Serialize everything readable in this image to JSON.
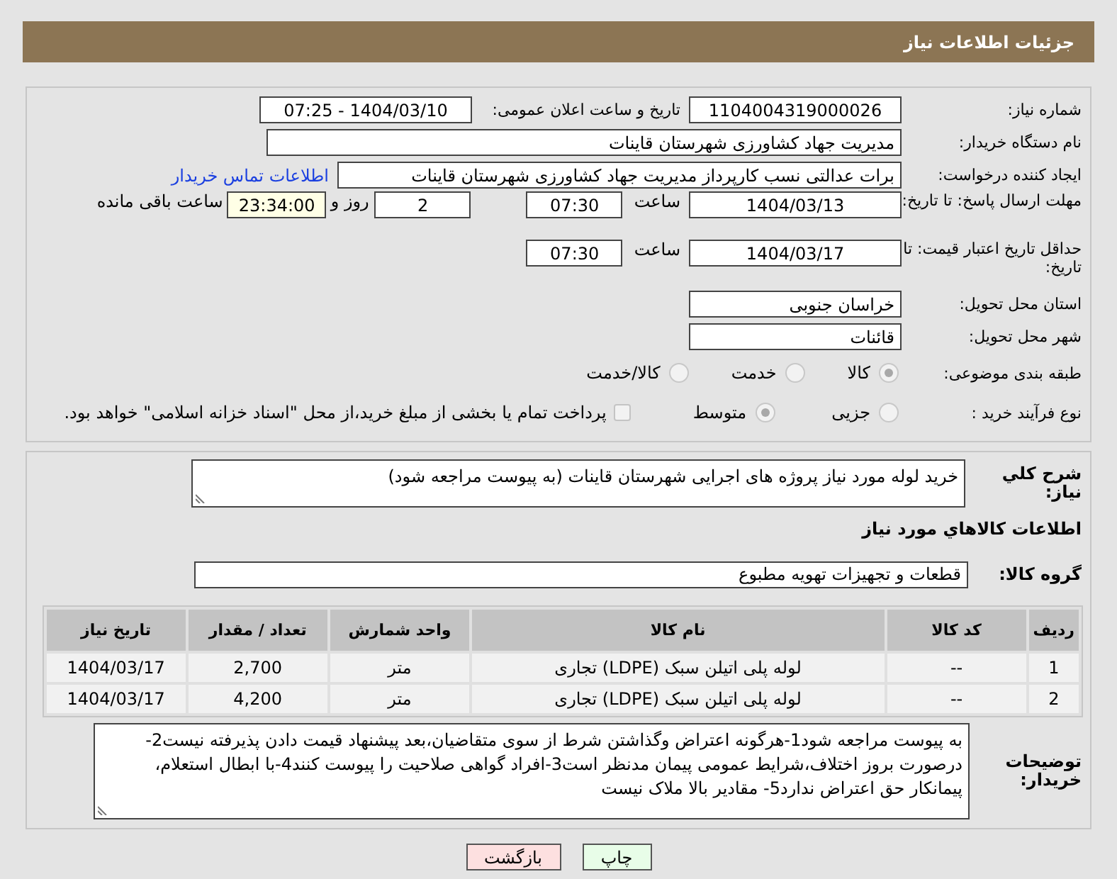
{
  "header": {
    "title": "جزئیات اطلاعات نیاز"
  },
  "need_number": {
    "label": "شماره نیاز:",
    "value": "1104004319000026"
  },
  "announce": {
    "label": "تاریخ و ساعت اعلان عمومی:",
    "value": "1404/03/10 - 07:25"
  },
  "buyer_org": {
    "label": "نام دستگاه خریدار:",
    "value": "مدیریت جهاد کشاورزی شهرستان قاینات"
  },
  "requester": {
    "label": "ایجاد کننده درخواست:",
    "value": "برات عدالتی نسب کارپرداز مدیریت جهاد کشاورزی شهرستان قاینات",
    "link": "اطلاعات تماس خریدار"
  },
  "response_deadline": {
    "label": "مهلت ارسال پاسخ: تا تاریخ:",
    "date": "1404/03/13",
    "time_label": "ساعت",
    "time": "07:30",
    "days": "2",
    "days_label": "روز و",
    "remaining": "23:34:00",
    "remaining_label": "ساعت باقی مانده"
  },
  "price_validity": {
    "label": "حداقل تاریخ اعتبار قیمت: تا تاریخ:",
    "date": "1404/03/17",
    "time_label": "ساعت",
    "time": "07:30"
  },
  "province": {
    "label": "استان محل تحویل:",
    "value": "خراسان جنوبی"
  },
  "city": {
    "label": "شهر محل تحویل:",
    "value": "قائنات"
  },
  "category": {
    "label": "طبقه بندی موضوعی:",
    "options": [
      {
        "label": "کالا",
        "selected": true
      },
      {
        "label": "خدمت",
        "selected": false
      },
      {
        "label": "کالا/خدمت",
        "selected": false
      }
    ]
  },
  "process": {
    "label": "نوع فرآیند خرید :",
    "options": [
      {
        "label": "جزیی",
        "selected": false
      },
      {
        "label": "متوسط",
        "selected": true
      }
    ],
    "treasury": {
      "label": "پرداخت تمام یا بخشی از مبلغ خرید،از محل \"اسناد خزانه اسلامی\" خواهد بود.",
      "checked": false
    }
  },
  "description": {
    "label": "شرح کلي نياز:",
    "value": "خرید لوله مورد نیاز پروژه های اجرایی شهرستان قاینات (به پیوست مراجعه شود)"
  },
  "goods_heading": "اطلاعات كالاهاي مورد نياز",
  "goods_group": {
    "label": "گروه کالا:",
    "value": "قطعات و تجهیزات تهویه مطبوع"
  },
  "table": {
    "columns": [
      "ردیف",
      "کد کالا",
      "نام کالا",
      "واحد شمارش",
      "تعداد / مقدار",
      "تاریخ نیاز"
    ],
    "rows": [
      [
        "1",
        "--",
        "لوله پلی اتیلن سبک (LDPE) تجاری",
        "متر",
        "2,700",
        "1404/03/17"
      ],
      [
        "2",
        "--",
        "لوله پلی اتیلن سبک (LDPE) تجاری",
        "متر",
        "4,200",
        "1404/03/17"
      ]
    ]
  },
  "buyer_notes": {
    "label": "توضیحات خریدار:",
    "value": "به پیوست مراجعه شود1-هرگونه اعتراض وگذاشتن شرط از سوی متقاضیان،بعد پیشنهاد قیمت دادن پذیرفته نیست2-درصورت بروز اختلاف،شرایط عمومی پیمان مدنظر است3-افراد گواهی صلاحیت را پیوست کنند4-با ابطال استعلام، پیمانکار حق اعتراض ندارد5- مقادیر بالا ملاک نیست"
  },
  "buttons": [
    {
      "label": "چاپ",
      "kind": "print"
    },
    {
      "label": "بازگشت",
      "kind": "back"
    }
  ]
}
